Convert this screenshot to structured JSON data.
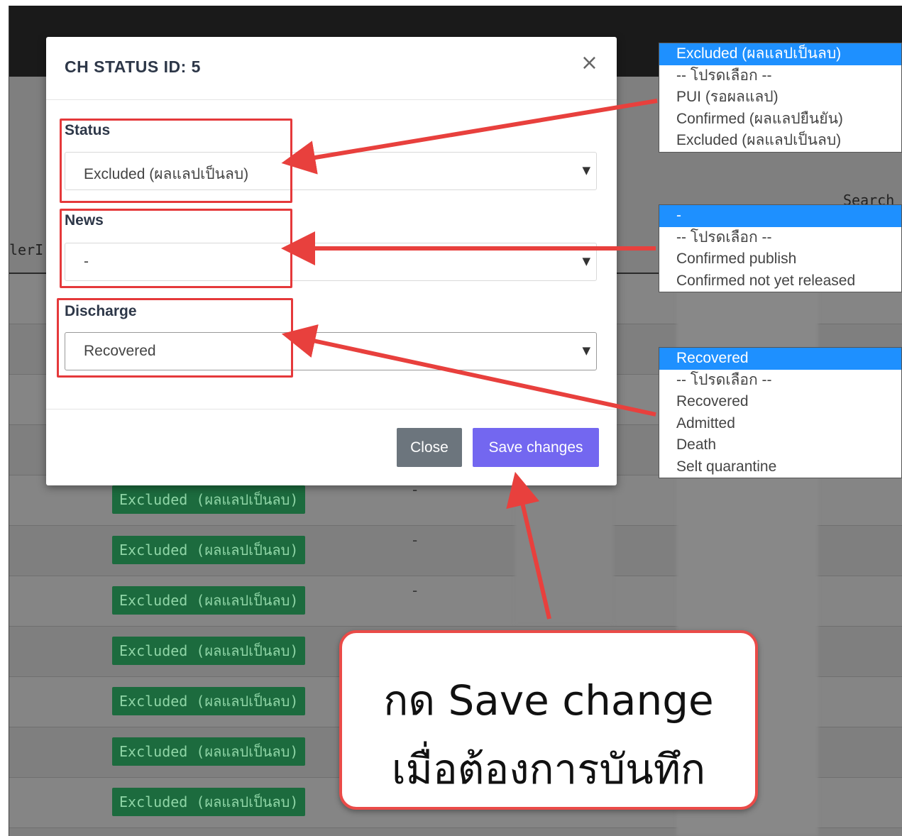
{
  "background": {
    "search_label": "Search",
    "column_header_fragment": "lerI",
    "rows": [
      {
        "badge": "",
        "dash": ""
      },
      {
        "badge": "",
        "dash": ""
      },
      {
        "badge": "",
        "dash": ""
      },
      {
        "badge": "",
        "dash": ""
      },
      {
        "badge": "Excluded (ผลแลปเป็นลบ)",
        "dash": "-"
      },
      {
        "badge": "Excluded (ผลแลปเป็นลบ)",
        "dash": "-"
      },
      {
        "badge": "Excluded (ผลแลปเป็นลบ)",
        "dash": "-"
      },
      {
        "badge": "Excluded (ผลแลปเป็นลบ)",
        "dash": ""
      },
      {
        "badge": "Excluded (ผลแลปเป็นลบ)",
        "dash": ""
      },
      {
        "badge": "Excluded (ผลแลปเป็นลบ)",
        "dash": ""
      },
      {
        "badge": "Excluded (ผลแลปเป็นลบ)",
        "dash": ""
      }
    ]
  },
  "modal": {
    "title": "CH STATUS ID: 5",
    "close_icon": "×",
    "fields": {
      "status": {
        "label": "Status",
        "value": "Excluded (ผลแลปเป็นลบ)"
      },
      "news": {
        "label": "News",
        "value": "-"
      },
      "discharge": {
        "label": "Discharge",
        "value": "Recovered"
      }
    },
    "caret": "▼",
    "buttons": {
      "close": "Close",
      "save": "Save changes"
    }
  },
  "dropdowns": {
    "status": {
      "selected": "Excluded (ผลแลปเป็นลบ)",
      "options": [
        "-- โปรดเลือก --",
        "PUI (รอผลแลป)",
        "Confirmed (ผลแลปยืนยัน)",
        "Excluded (ผลแลปเป็นลบ)"
      ]
    },
    "news": {
      "selected": "-",
      "options": [
        "-- โปรดเลือก --",
        "Confirmed publish",
        "Confirmed not yet released"
      ]
    },
    "discharge": {
      "selected": "Recovered",
      "options": [
        "-- โปรดเลือก --",
        "Recovered",
        "Admitted",
        "Death",
        "Selt quarantine"
      ]
    }
  },
  "callout": {
    "line1": "กด Save change",
    "line2": "เมื่อต้องการบันทึก"
  },
  "colors": {
    "highlight_red": "#e5393b",
    "save_button": "#7367f0",
    "close_button": "#6c757d",
    "badge_green": "#1c6b3e",
    "selected_option": "#1e90ff"
  }
}
